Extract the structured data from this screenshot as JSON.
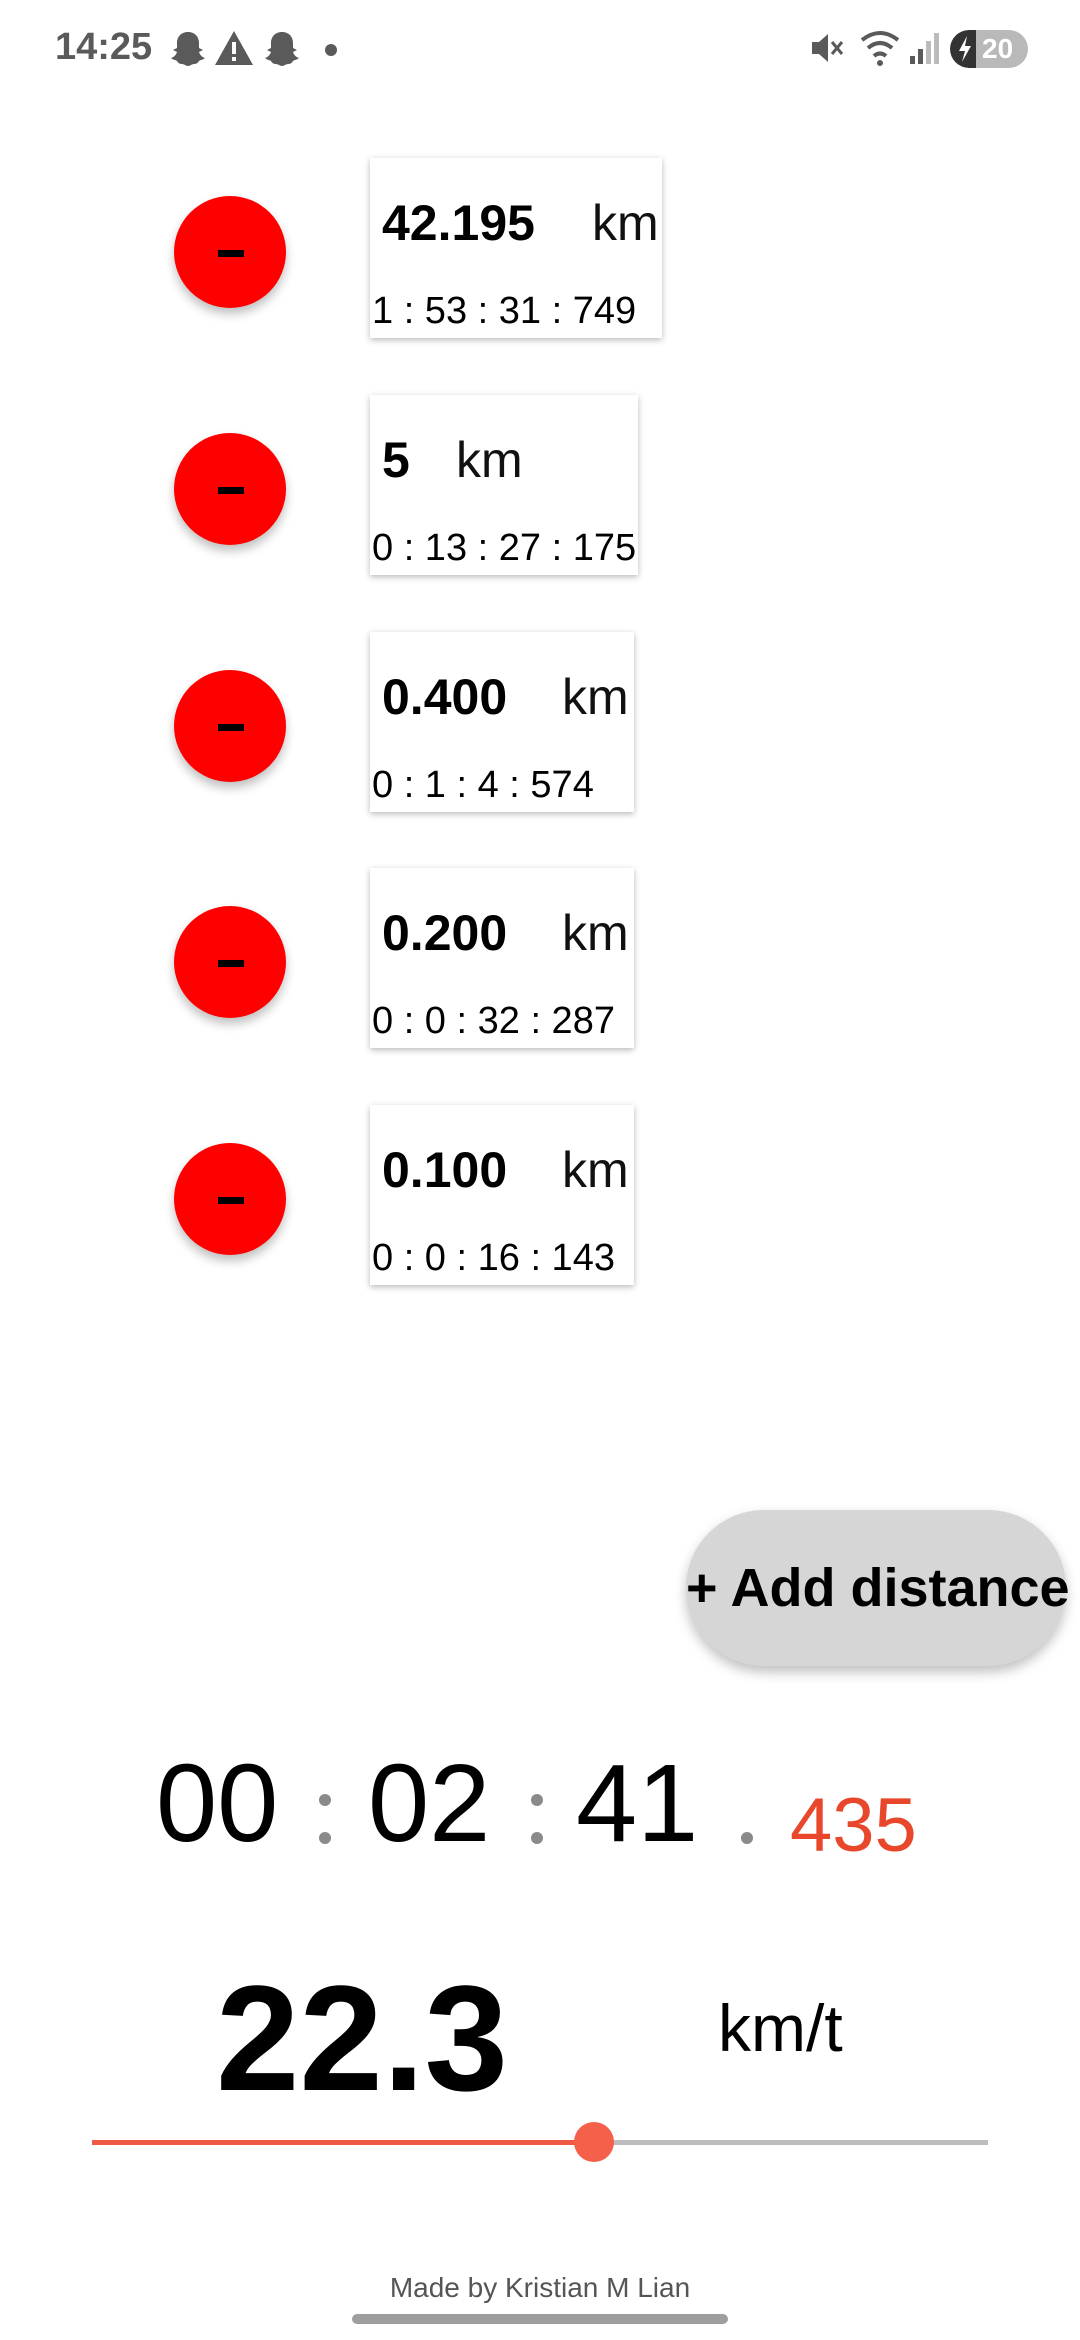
{
  "status_bar": {
    "time": "14:25",
    "battery": "20",
    "icons": [
      "snapchat-ghost-icon",
      "warning-icon",
      "snapchat-ghost-icon",
      "dot-icon",
      "mute-icon",
      "wifi-icon",
      "signal-icon",
      "battery-charging-icon"
    ]
  },
  "distances": [
    {
      "remove_label": "-",
      "distance": "42.195",
      "unit": "km",
      "time": "1 : 53 : 31 : 749"
    },
    {
      "remove_label": "-",
      "distance": "5",
      "unit": "km",
      "time": "0 : 13 : 27 : 175"
    },
    {
      "remove_label": "-",
      "distance": "0.400",
      "unit": "km",
      "time": "0 : 1 : 4 : 574"
    },
    {
      "remove_label": "-",
      "distance": "0.200",
      "unit": "km",
      "time": "0 : 0 : 32 : 287"
    },
    {
      "remove_label": "-",
      "distance": "0.100",
      "unit": "km",
      "time": "0 : 0 : 16 : 143"
    }
  ],
  "add_button": {
    "label": "+ Add distance"
  },
  "timer": {
    "hours": "00",
    "minutes": "02",
    "seconds": "41",
    "millis": "435"
  },
  "speed": {
    "value": "22.3",
    "unit": "km/t"
  },
  "slider": {
    "fraction": 0.56
  },
  "footer": {
    "credit": "Made by Kristian M Lian"
  },
  "colors": {
    "remove": "#ff0000",
    "accent": "#e8472c",
    "add_button": "#d6d6d6"
  }
}
